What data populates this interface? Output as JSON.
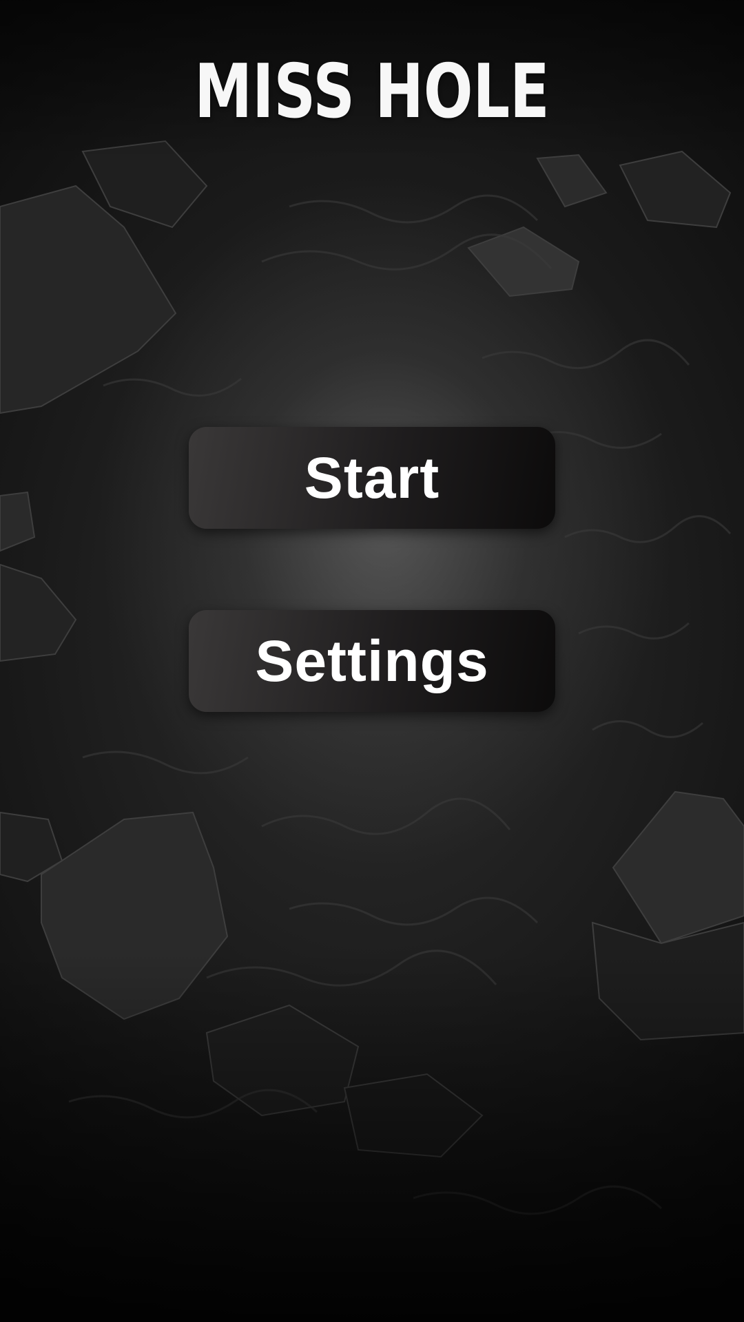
{
  "game": {
    "title": "MISS HOLE"
  },
  "menu": {
    "start_label": "Start",
    "settings_label": "Settings"
  },
  "colors": {
    "text": "#ffffff",
    "button_light": "#3a3838",
    "button_dark": "#0c0b0b",
    "background": "#1a1a1a"
  }
}
